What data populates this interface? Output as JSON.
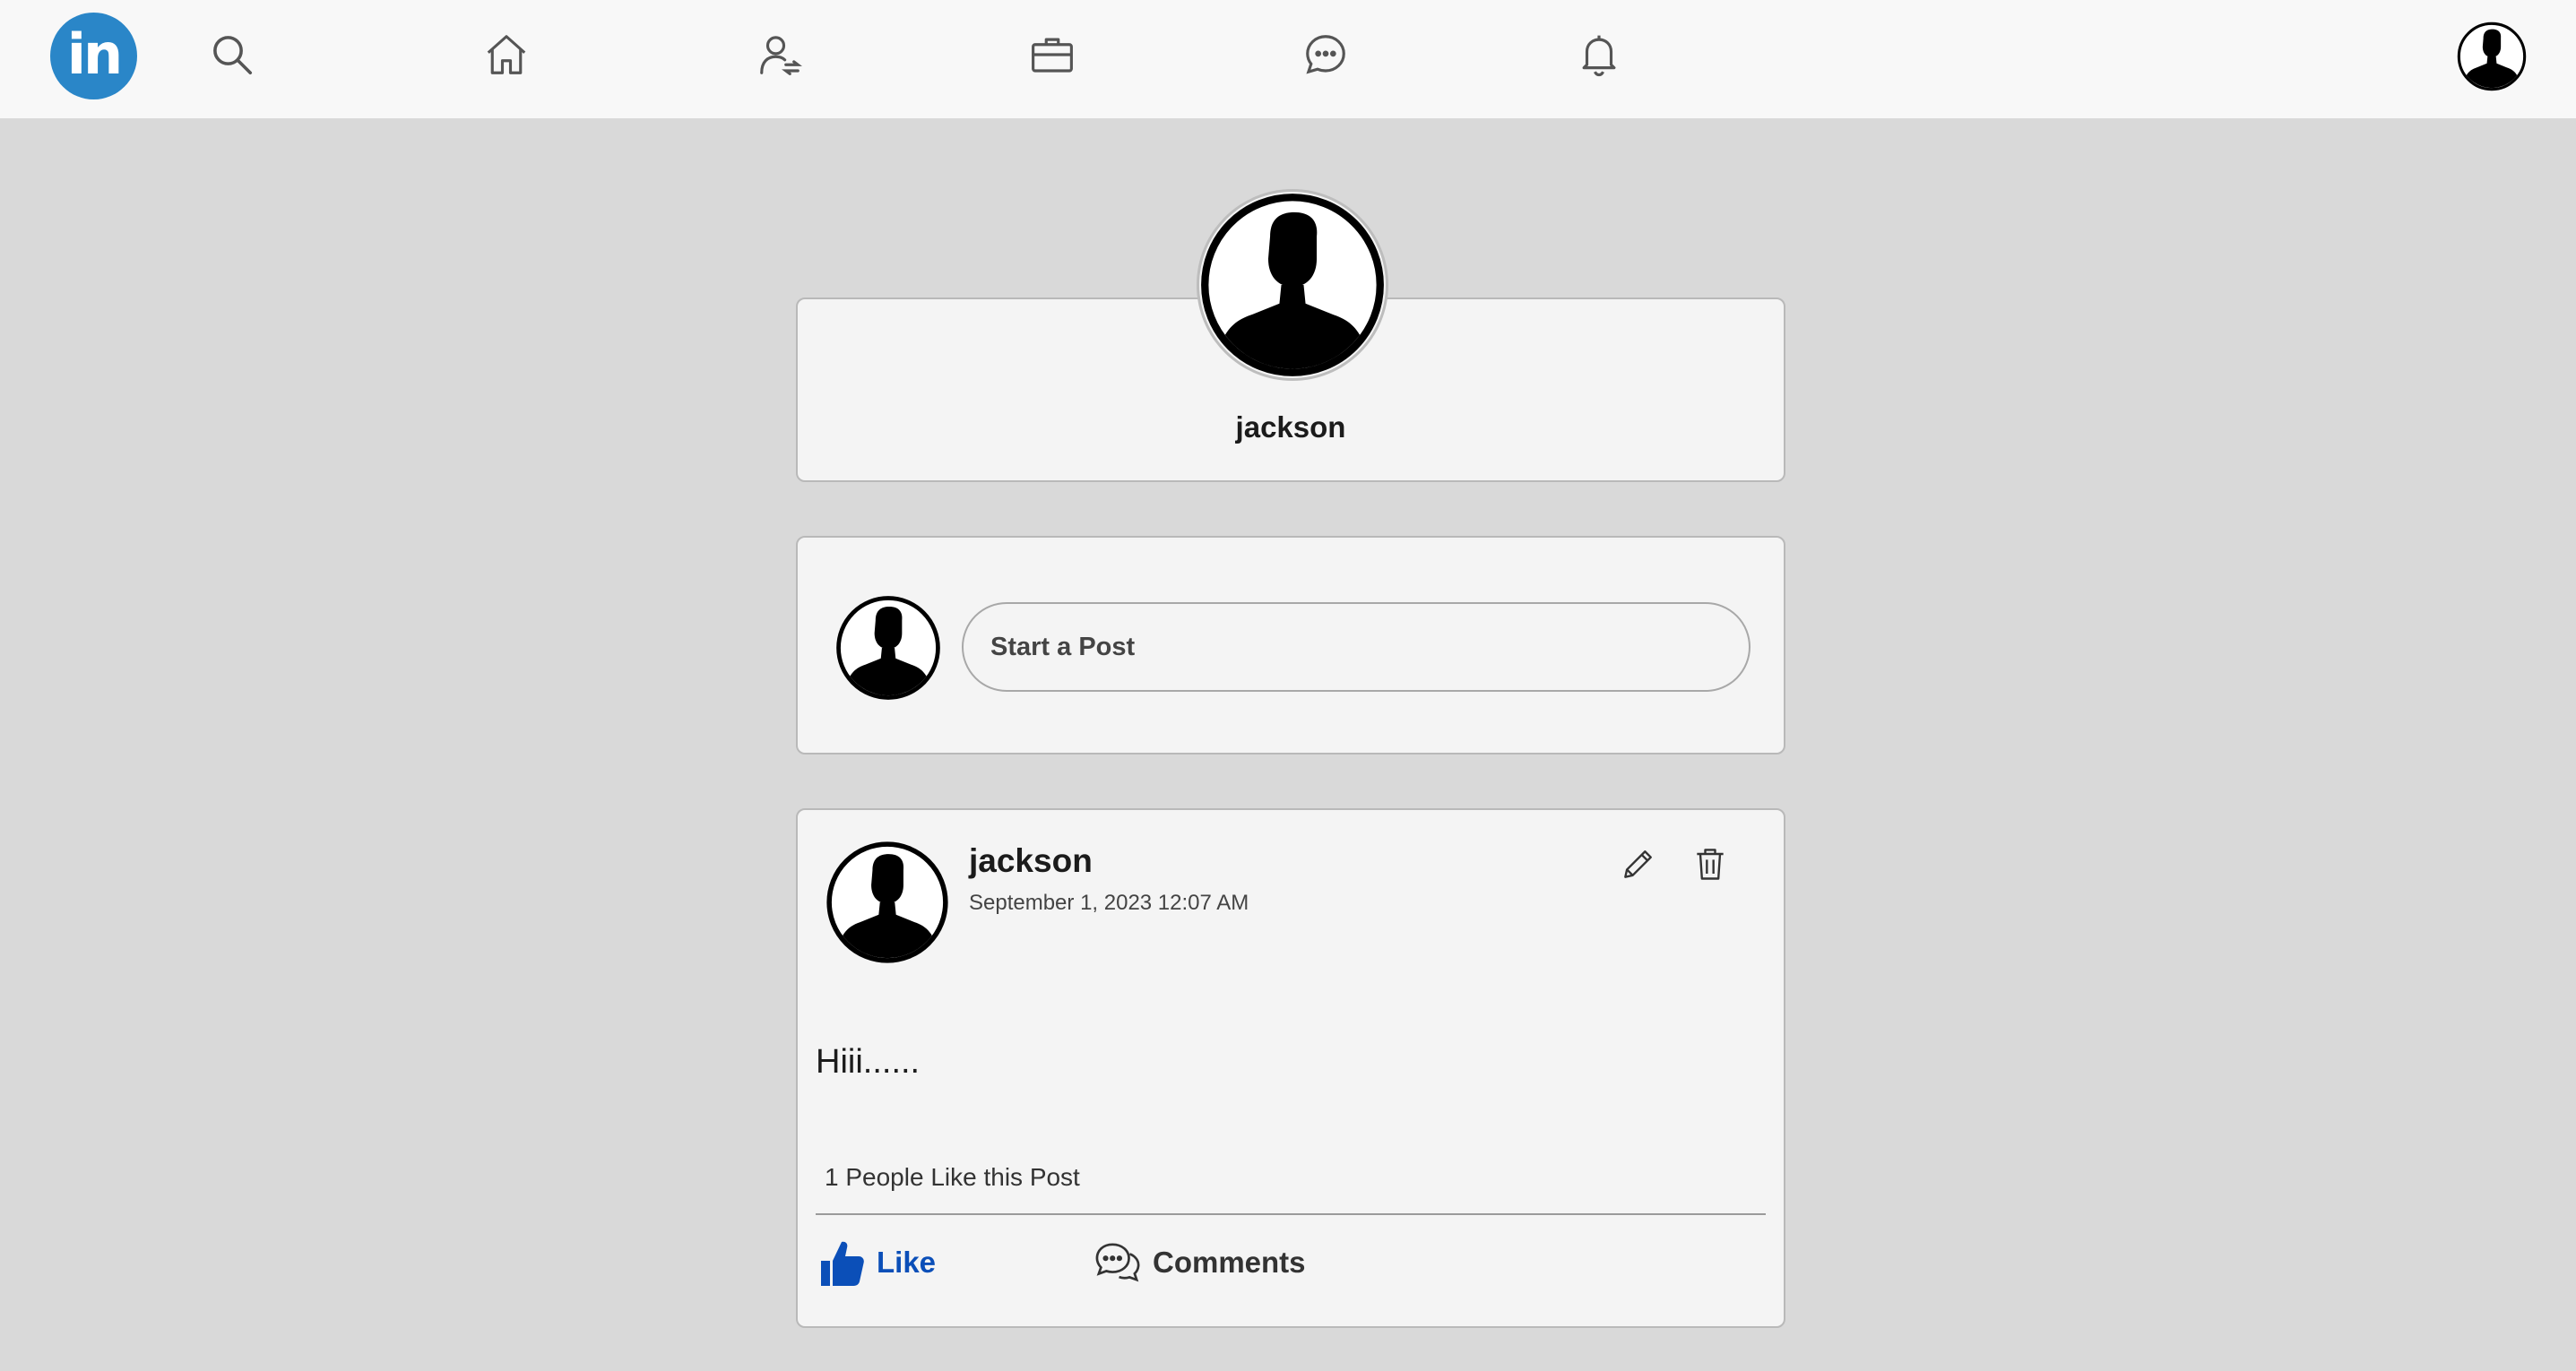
{
  "nav": {
    "logo_text": "in",
    "icons": [
      "search-icon",
      "home-icon",
      "network-icon",
      "jobs-icon",
      "messaging-icon",
      "notifications-icon"
    ]
  },
  "profile": {
    "name": "jackson"
  },
  "compose": {
    "placeholder": "Start a Post"
  },
  "post": {
    "author": "jackson",
    "timestamp": "September 1, 2023 12:07 AM",
    "body": "Hiii......",
    "likes_text": "1 People Like this Post",
    "like_label": "Like",
    "comments_label": "Comments"
  },
  "colors": {
    "brand": "#2a86c8",
    "like_blue": "#0b4fb8",
    "background": "#d9d9d9",
    "card": "#f4f4f4"
  }
}
